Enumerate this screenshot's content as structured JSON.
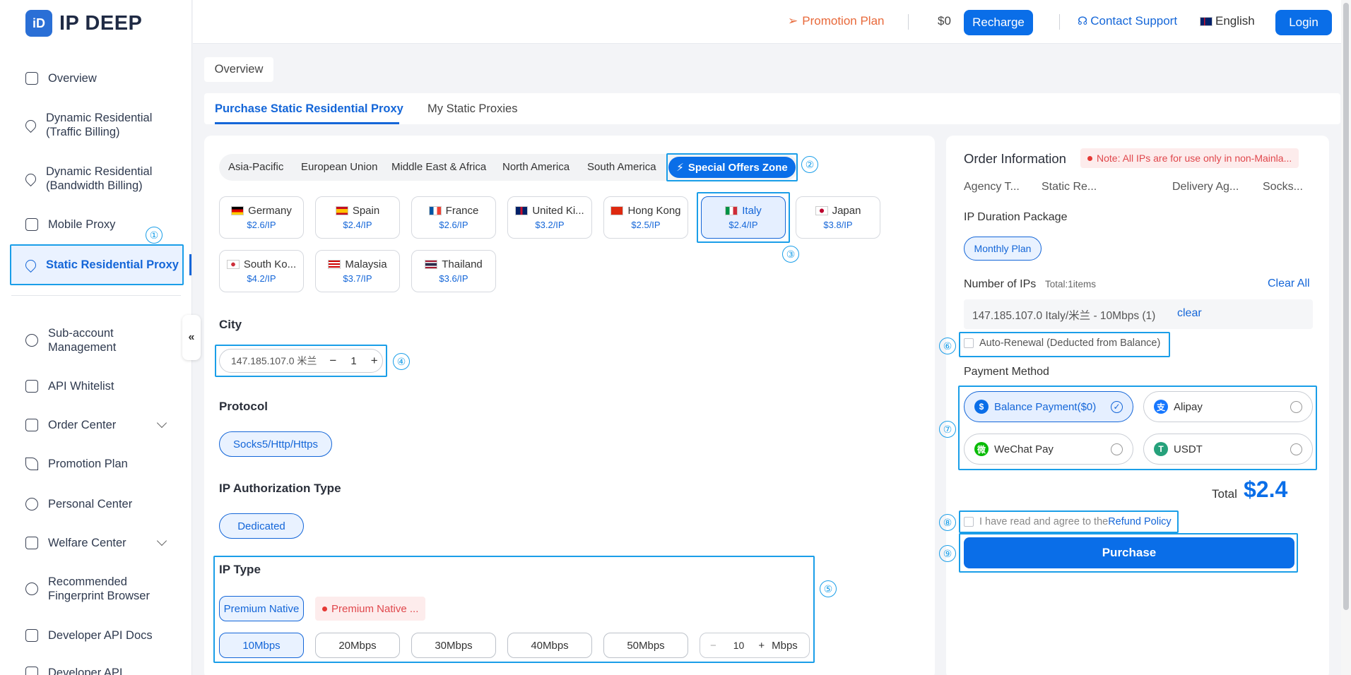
{
  "brand": {
    "logo_mark": "iD",
    "name": "IP DEEP"
  },
  "sidebar": {
    "items": [
      {
        "label": "Overview",
        "icon": "calendar-icon"
      },
      {
        "label": "Dynamic Residential (Traffic Billing)",
        "icon": "location-icon"
      },
      {
        "label": "Dynamic Residential (Bandwidth Billing)",
        "icon": "location-icon"
      },
      {
        "label": "Mobile Proxy",
        "icon": "phone-icon"
      },
      {
        "label": "Static Residential Proxy",
        "icon": "location-icon",
        "active": true
      },
      {
        "label": "Sub-account Management",
        "icon": "users-icon"
      },
      {
        "label": "API Whitelist",
        "icon": "file-icon"
      },
      {
        "label": "Order Center",
        "icon": "clipboard-icon"
      },
      {
        "label": "Promotion Plan",
        "icon": "send-icon"
      },
      {
        "label": "Personal Center",
        "icon": "person-icon"
      },
      {
        "label": "Welfare Center",
        "icon": "ticket-icon"
      },
      {
        "label": "Recommended Fingerprint Browser",
        "icon": "fingerprint-icon"
      },
      {
        "label": "Developer API Docs",
        "icon": "doc-icon"
      },
      {
        "label": "Developer API",
        "icon": "code-icon"
      }
    ],
    "collapse_label": "«"
  },
  "header": {
    "promotion": "Promotion Plan",
    "balance": "$0",
    "recharge": "Recharge",
    "support": "Contact Support",
    "language": "English",
    "login": "Login"
  },
  "breadcrumb": "Overview",
  "tabs": [
    "Purchase Static Residential Proxy",
    "My Static Proxies"
  ],
  "regions": [
    "Asia-Pacific",
    "European Union",
    "Middle East & Africa",
    "North America",
    "South America"
  ],
  "special_offers": "Special Offers Zone",
  "countries": [
    {
      "name": "Germany",
      "price": "$2.6/IP",
      "flag": [
        "#000000",
        "#dd0000",
        "#ffce00"
      ]
    },
    {
      "name": "Spain",
      "price": "$2.4/IP",
      "flag": [
        "#c60b1e",
        "#ffc400",
        "#c60b1e"
      ]
    },
    {
      "name": "France",
      "price": "$2.6/IP",
      "flag": [
        "#0055a4",
        "#ffffff",
        "#ef4135"
      ]
    },
    {
      "name": "United Ki...",
      "price": "$3.2/IP",
      "flag": [
        "#012169",
        "#ffffff",
        "#c8102e"
      ]
    },
    {
      "name": "Hong Kong",
      "price": "$2.5/IP",
      "flag": [
        "#de2910",
        "#de2910",
        "#de2910"
      ]
    },
    {
      "name": "Italy",
      "price": "$2.4/IP",
      "flag": [
        "#009246",
        "#ffffff",
        "#ce2b37"
      ],
      "selected": true
    },
    {
      "name": "Japan",
      "price": "$3.8/IP",
      "flag": [
        "#ffffff",
        "#bc002d",
        "#ffffff"
      ]
    },
    {
      "name": "South Ko...",
      "price": "$4.2/IP",
      "flag": [
        "#ffffff",
        "#cd2e3a",
        "#ffffff"
      ]
    },
    {
      "name": "Malaysia",
      "price": "$3.7/IP",
      "flag": [
        "#cc0001",
        "#ffffff",
        "#010066"
      ]
    },
    {
      "name": "Thailand",
      "price": "$3.6/IP",
      "flag": [
        "#a51931",
        "#2d2a4a",
        "#a51931"
      ]
    }
  ],
  "city": {
    "title": "City",
    "value": "147.185.107.0 米兰",
    "qty": "1",
    "minus": "−",
    "plus": "+"
  },
  "protocol": {
    "title": "Protocol",
    "value": "Socks5/Http/Https"
  },
  "auth_type": {
    "title": "IP Authorization Type",
    "value": "Dedicated"
  },
  "ip_type": {
    "title": "IP Type",
    "options": [
      "Premium Native",
      "Premium Native ..."
    ],
    "bandwidths": [
      "10Mbps",
      "20Mbps",
      "30Mbps",
      "40Mbps",
      "50Mbps"
    ],
    "custom_value": "10",
    "custom_unit": "Mbps"
  },
  "markers": [
    "①",
    "②",
    "③",
    "④",
    "⑤",
    "⑥",
    "⑦",
    "⑧",
    "⑨"
  ],
  "order": {
    "title": "Order Information",
    "note": "Note: All IPs are for use only in non-Mainla...",
    "columns": [
      "Agency T...",
      "Static Re...",
      "Delivery Ag...",
      "Socks..."
    ],
    "duration_title": "IP Duration Package",
    "duration_value": "Monthly Plan",
    "num_title": "Number of IPs",
    "num_total": "Total:1items",
    "clear_all": "Clear All",
    "ip_entry": "147.185.107.0 Italy/米兰 - 10Mbps (1)",
    "clear": "clear",
    "auto_renew": "Auto-Renewal (Deducted from Balance)",
    "payment_title": "Payment Method",
    "payments": [
      {
        "label": "Balance Payment($0)",
        "icon": "$",
        "color": "#0a6ee8",
        "selected": true
      },
      {
        "label": "Alipay",
        "icon": "支",
        "color": "#1677ff"
      },
      {
        "label": "WeChat Pay",
        "icon": "微",
        "color": "#09bb07"
      },
      {
        "label": "USDT",
        "icon": "T",
        "color": "#26a17b"
      }
    ],
    "total_label": "Total",
    "total_value": "$2.4",
    "agree_text": "I have read and agree to the",
    "refund_policy": "Refund Policy",
    "purchase": "Purchase"
  }
}
